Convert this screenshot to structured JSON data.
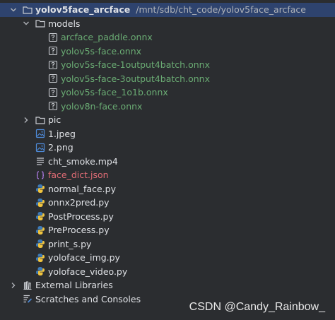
{
  "project": {
    "name": "yolov5face_arcface",
    "path": "/mnt/sdb/cht_code/yolov5face_arcface"
  },
  "folders": {
    "models": {
      "name": "models",
      "files": [
        "arcface_paddle.onnx",
        "yolov5s-face.onnx",
        "yolov5s-face-1output4batch.onnx",
        "yolov5s-face-3output4batch.onnx",
        "yolov5s-face_1o1b.onnx",
        "yolov8n-face.onnx"
      ]
    },
    "pic": {
      "name": "pic"
    }
  },
  "files": {
    "images": [
      "1.jpeg",
      "2.png"
    ],
    "video": "cht_smoke.mp4",
    "json": "face_dict.json",
    "python": [
      "normal_face.py",
      "onnx2pred.py",
      "PostProcess.py",
      "PreProcess.py",
      "print_s.py",
      "yoloface_img.py",
      "yoloface_video.py"
    ]
  },
  "external_libraries": "External Libraries",
  "scratches": "Scratches and Consoles",
  "watermark": "CSDN @Candy_Rainbow_",
  "colors": {
    "background": "#2b2d30",
    "selection": "#2e436e",
    "unknown_file_text": "#6aab73",
    "json_text": "#e06c75"
  },
  "icons": {
    "folder": "folder-icon",
    "unknown": "unknown-file-icon",
    "image": "image-file-icon",
    "text": "text-file-icon",
    "json": "json-file-icon",
    "python": "python-file-icon",
    "libraries": "libraries-icon",
    "scratches": "scratches-icon"
  }
}
